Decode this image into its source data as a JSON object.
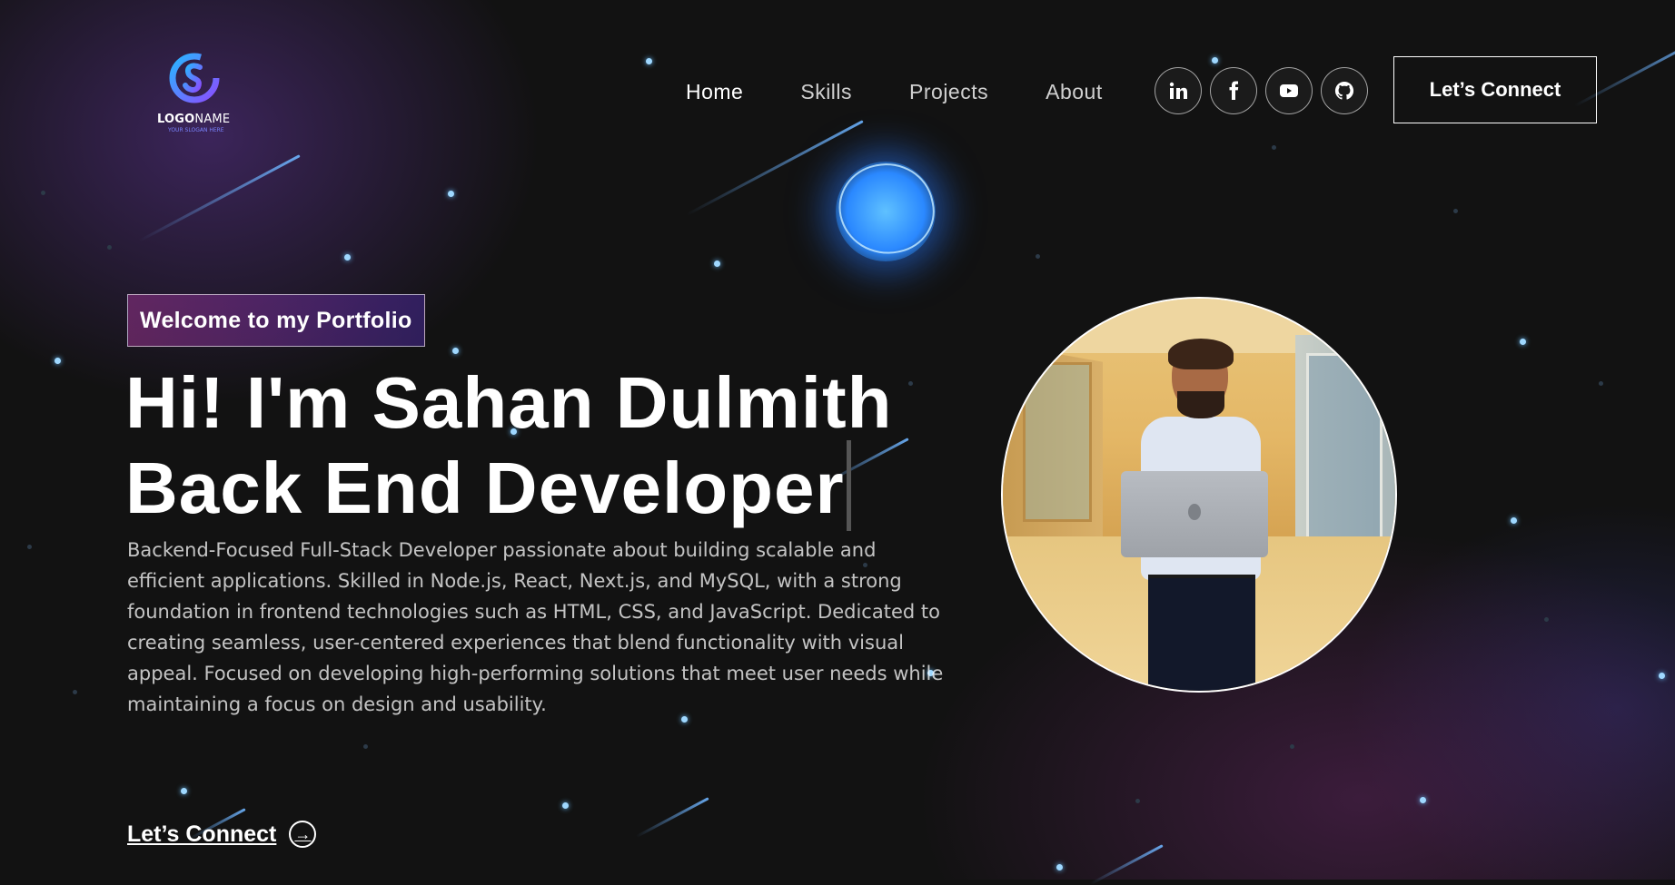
{
  "brand": {
    "logo_text_bold": "LOGO",
    "logo_text_light": "NAME",
    "slogan": "YOUR SLOGAN HERE",
    "icon": "dollar-s-logo-icon"
  },
  "nav": {
    "items": [
      {
        "label": "Home"
      },
      {
        "label": "Skills"
      },
      {
        "label": "Projects"
      },
      {
        "label": "About"
      }
    ],
    "socials": [
      {
        "name": "linkedin-icon"
      },
      {
        "name": "facebook-icon"
      },
      {
        "name": "youtube-icon"
      },
      {
        "name": "github-icon"
      }
    ],
    "cta_label": "Let’s Connect"
  },
  "hero": {
    "tagline": "Welcome to my Portfolio",
    "heading_line1": "Hi! I'm Sahan Dulmith",
    "heading_line2": "Back End Developer",
    "description": "Backend-Focused Full-Stack Developer passionate about building scalable and efficient applications. Skilled in Node.js, React, Next.js, and MySQL, with a strong foundation in frontend technologies such as HTML, CSS, and JavaScript. Dedicated to creating seamless, user-centered experiences that blend functionality with visual appeal. Focused on developing high-performing solutions that meet user needs while maintaining a focus on design and usability.",
    "cta_label": "Let’s Connect",
    "cta_icon": "arrow-right-circle-icon"
  },
  "colors": {
    "background": "#121212",
    "accent_purple": "#7a83ff",
    "star": "#9fd8ff"
  }
}
